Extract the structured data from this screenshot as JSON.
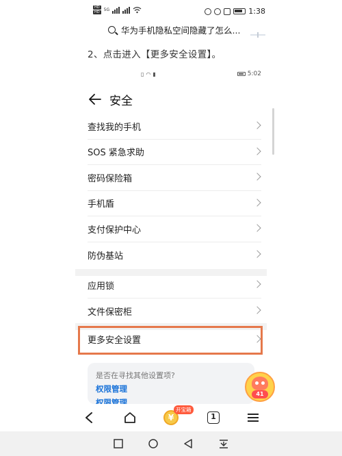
{
  "status_bar": {
    "sim1": "HD",
    "sim2": "HD",
    "network": "5G",
    "time": "1:38"
  },
  "search": {
    "query": "华为手机隐私空间隐藏了怎么..."
  },
  "instruction": "2、点击进入【更多安全设置】。",
  "inner_status": {
    "time": "5:02"
  },
  "page": {
    "title": "安全",
    "group1": [
      "查找我的手机",
      "SOS 紧急求助",
      "密码保险箱",
      "手机盾",
      "支付保护中心",
      "防伪基站"
    ],
    "group2": [
      "应用锁",
      "文件保密柜"
    ],
    "group3": [
      "更多安全设置"
    ]
  },
  "hint": {
    "question": "是否在寻找其他设置项?",
    "link1": "权限管理",
    "link2": "权限管理"
  },
  "float": {
    "count": "41"
  },
  "browser_nav": {
    "coin_symbol": "¥",
    "coin_badge": "开宝箱",
    "tabs_count": "1"
  },
  "colors": {
    "highlight": "#e5784b",
    "link": "#1a73d9"
  }
}
